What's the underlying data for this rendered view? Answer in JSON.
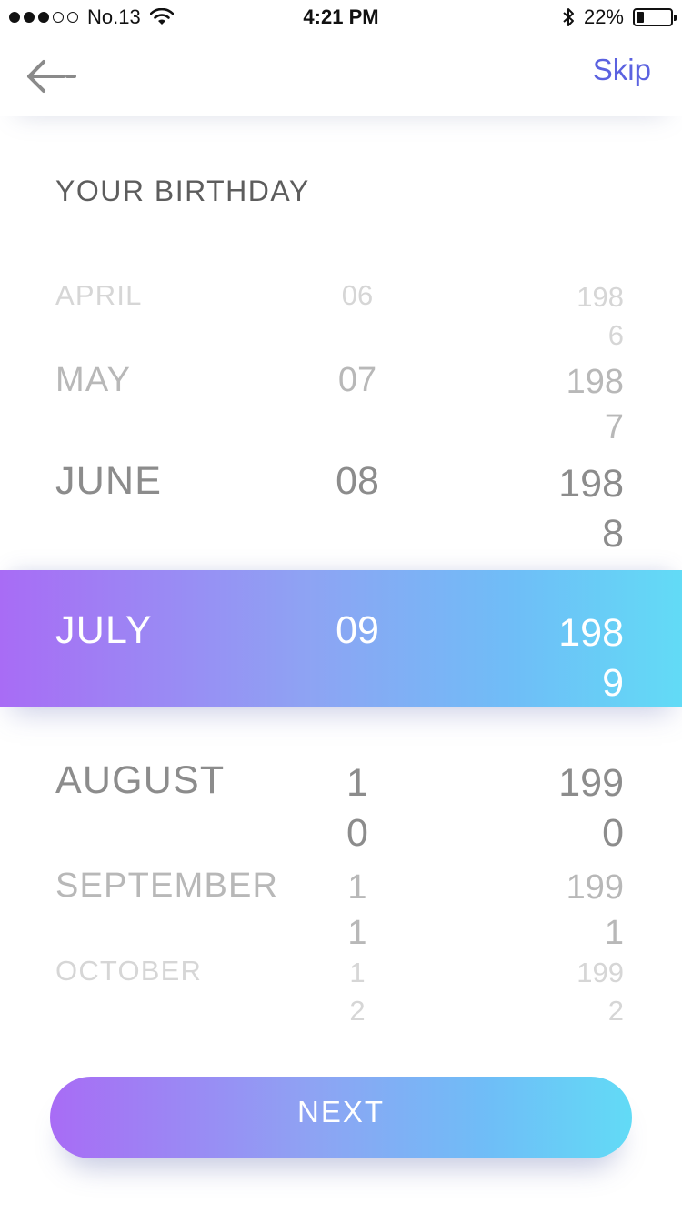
{
  "status_bar": {
    "carrier": "No.13",
    "time": "4:21 PM",
    "battery_text": "22%",
    "battery_level": 0.22,
    "signal_filled": 3,
    "signal_empty": 2,
    "icons": [
      "wifi-icon",
      "bluetooth-icon",
      "battery-icon"
    ]
  },
  "nav": {
    "back_icon": "arrow-left-icon",
    "skip_label": "Skip",
    "skip_color": "#5b62e0"
  },
  "title": "YOUR BIRTHDAY",
  "picker": {
    "rows": [
      {
        "month": "APRIL",
        "day": "06",
        "year_l1": "198",
        "year_l2": "6"
      },
      {
        "month": "MAY",
        "day": "07",
        "year_l1": "198",
        "year_l2": "7"
      },
      {
        "month": "JUNE",
        "day": "08",
        "year_l1": "198",
        "year_l2": "8"
      },
      {
        "month": "JULY",
        "day": "09",
        "year_l1": "198",
        "year_l2": "9"
      },
      {
        "month": "AUGUST",
        "day_l1": "1",
        "day_l2": "0",
        "year_l1": "199",
        "year_l2": "0"
      },
      {
        "month": "SEPTEMBER",
        "day_l1": "1",
        "day_l2": "1",
        "year_l1": "199",
        "year_l2": "1"
      },
      {
        "month": "OCTOBER",
        "day_l1": "1",
        "day_l2": "2",
        "year_l1": "199",
        "year_l2": "2"
      }
    ],
    "selected_index": 3
  },
  "next_label": "NEXT",
  "colors": {
    "gradient_start": "#a86cf5",
    "gradient_end": "#62dbf6",
    "title_text": "#5d5d5d"
  }
}
